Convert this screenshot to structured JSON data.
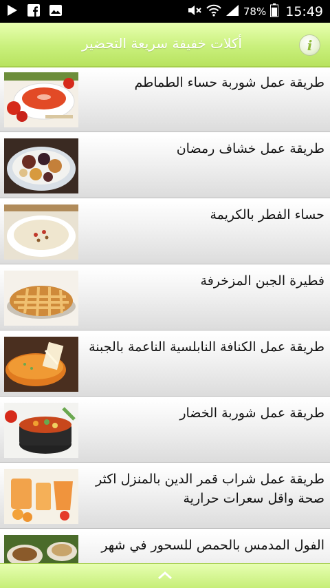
{
  "status_bar": {
    "battery_percent": "78%",
    "time": "15:49",
    "left_icons": [
      "play-icon",
      "facebook-icon",
      "image-icon"
    ],
    "right_icons": [
      "mute-icon",
      "wifi-icon",
      "signal-icon",
      "battery-icon"
    ]
  },
  "header": {
    "title": "أكلات خفيفة سريعة التحضير",
    "info_label": "i"
  },
  "colors": {
    "header_green": "#c9f07c",
    "list_bg": "#f2f2f2",
    "info_icon": "#8fbb3a"
  },
  "items": [
    {
      "title": "طريقة عمل شوربة حساء الطماطم",
      "thumb": "tomato-soup"
    },
    {
      "title": "طريقة عمل خشاف رمضان",
      "thumb": "dried-fruit-khoshaf"
    },
    {
      "title": "حساء الفطر بالكريمة",
      "thumb": "mushroom-cream-soup"
    },
    {
      "title": "فطيرة الجبن المزخرفة",
      "thumb": "lattice-pie"
    },
    {
      "title": "طريقة عمل الكنافة النابلسية الناعمة بالجبنة",
      "thumb": "kunafa"
    },
    {
      "title": "طريقة عمل شوربة الخضار",
      "thumb": "vegetable-soup"
    },
    {
      "title": "طريقة عمل شراب قمر الدين بالمنزل اكثر صحة واقل سعرات حرارية",
      "thumb": "apricot-drink"
    },
    {
      "title": "الفول المدمس بالحمص للسحور في شهر",
      "thumb": "foul-medames"
    }
  ],
  "bottom_bar": {
    "icon": "chevron-up-icon"
  }
}
